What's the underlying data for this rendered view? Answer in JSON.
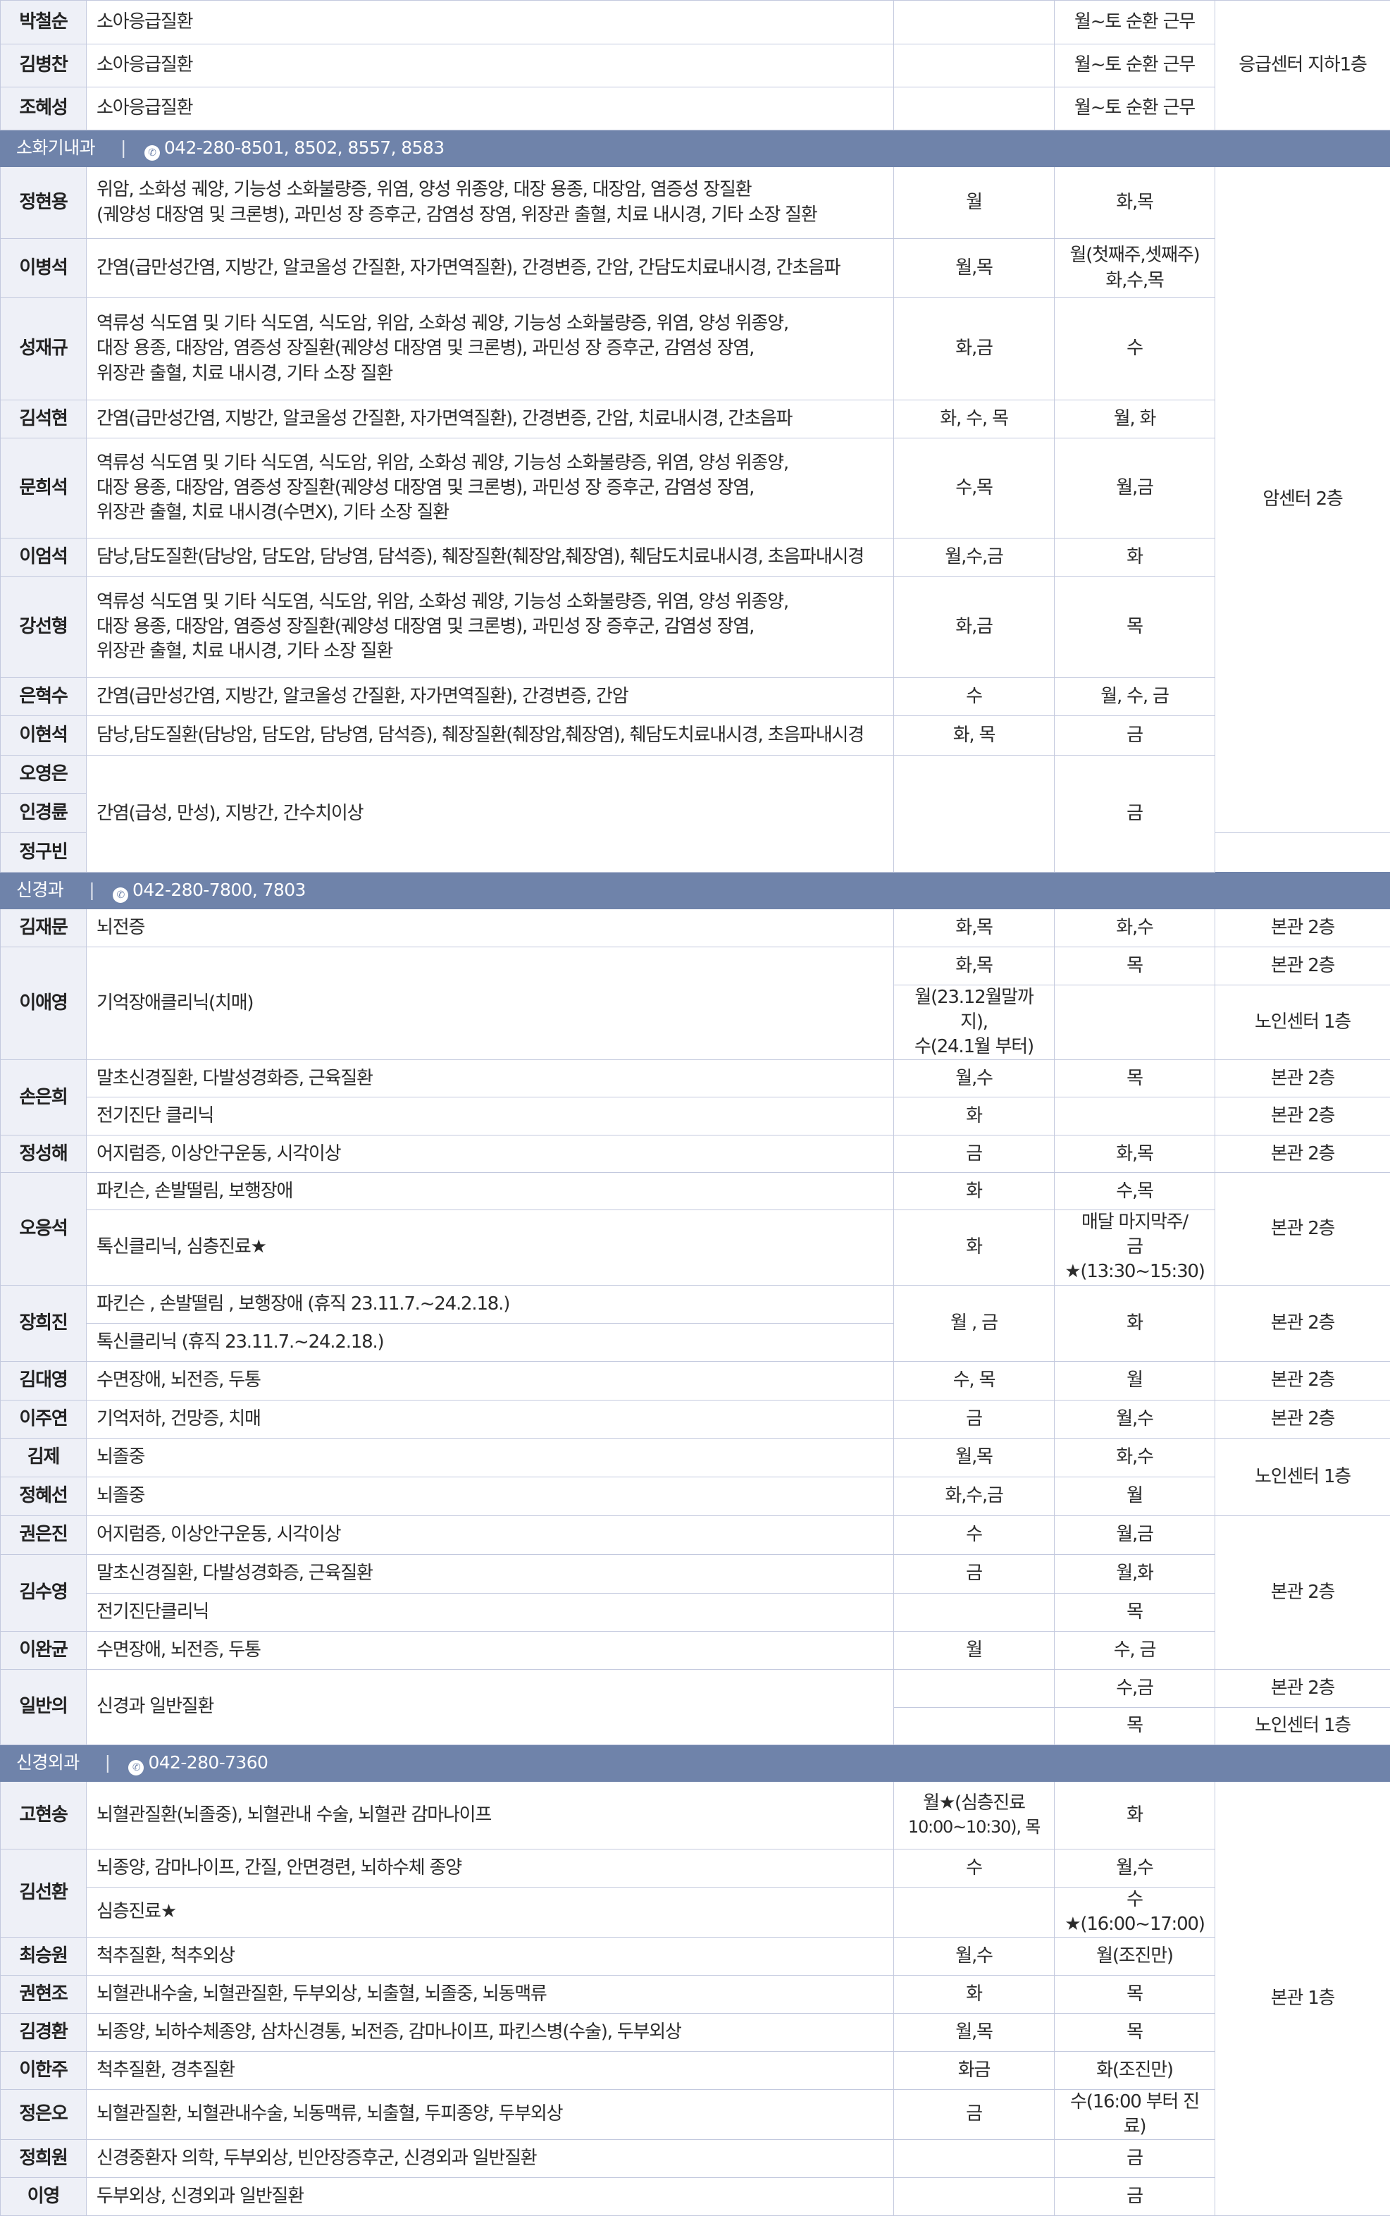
{
  "top": {
    "rows": [
      {
        "name": "박철순",
        "dx": "소아응급질환",
        "am": "",
        "pm": "월~토 순환 근무"
      },
      {
        "name": "김병찬",
        "dx": "소아응급질환",
        "am": "",
        "pm": "월~토 순환 근무"
      },
      {
        "name": "조혜성",
        "dx": "소아응급질환",
        "am": "",
        "pm": "월~토 순환 근무"
      }
    ],
    "loc": "응급센터 지하1층"
  },
  "gi": {
    "dept": "소화기내과",
    "phone": "042-280-8501, 8502, 8557, 8583",
    "phone_icon": "phone-icon",
    "loc": "암센터 2층",
    "r1": {
      "name": "정현용",
      "dx1": "위암, 소화성 궤양, 기능성 소화불량증, 위염, 양성 위종양, 대장 용종, 대장암, 염증성 장질환",
      "dx2": "(궤양성 대장염 및 크론병), 과민성 장 증후군, 감염성 장염, 위장관 출혈, 치료 내시경, 기타 소장 질환",
      "am": "월",
      "pm": "화,목"
    },
    "r2": {
      "name": "이병석",
      "dx": "간염(급만성간염, 지방간, 알코올성 간질환, 자가면역질환), 간경변증, 간암, 간담도치료내시경, 간초음파",
      "am": "월,목",
      "pm1": "월(첫째주,셋째주)",
      "pm2": "화,수,목"
    },
    "r3": {
      "name": "성재규",
      "dx1": "역류성 식도염 및 기타 식도염, 식도암, 위암, 소화성 궤양, 기능성 소화불량증, 위염, 양성 위종양,",
      "dx2": "대장 용종, 대장암, 염증성 장질환(궤양성 대장염 및 크론병), 과민성 장 증후군, 감염성 장염,",
      "dx3": "위장관 출혈, 치료 내시경, 기타 소장 질환",
      "am": "화,금",
      "pm": "수"
    },
    "r4": {
      "name": "김석현",
      "dx": "간염(급만성간염, 지방간, 알코올성 간질환, 자가면역질환), 간경변증, 간암, 치료내시경, 간초음파",
      "am": "화, 수, 목",
      "pm": "월, 화"
    },
    "r5": {
      "name": "문희석",
      "dx1": "역류성 식도염 및 기타 식도염, 식도암, 위암, 소화성 궤양, 기능성 소화불량증, 위염, 양성 위종양,",
      "dx2": "대장 용종, 대장암, 염증성 장질환(궤양성 대장염 및 크론병), 과민성 장 증후군, 감염성 장염,",
      "dx3": "위장관 출혈, 치료 내시경(수면X), 기타 소장 질환",
      "am": "수,목",
      "pm": "월,금"
    },
    "r6": {
      "name": "이엄석",
      "dx": "담낭,담도질환(담낭암, 담도암, 담낭염, 담석증), 췌장질환(췌장암,췌장염), 췌담도치료내시경, 초음파내시경",
      "am": "월,수,금",
      "pm": "화"
    },
    "r7": {
      "name": "강선형",
      "dx1": "역류성 식도염 및 기타 식도염, 식도암, 위암, 소화성 궤양, 기능성 소화불량증, 위염, 양성 위종양,",
      "dx2": "대장 용종, 대장암, 염증성 장질환(궤양성 대장염 및 크론병), 과민성 장 증후군, 감염성 장염,",
      "dx3": "위장관 출혈, 치료 내시경, 기타 소장 질환",
      "am": "화,금",
      "pm": "목"
    },
    "r8": {
      "name": "은혁수",
      "dx": "간염(급만성간염, 지방간, 알코올성 간질환, 자가면역질환), 간경변증, 간암",
      "am": "수",
      "pm": "월, 수, 금"
    },
    "r9": {
      "name": "이현석",
      "dx": "담낭,담도질환(담낭암, 담도암, 담낭염, 담석증), 췌장질환(췌장암,췌장염), 췌담도치료내시경, 초음파내시경",
      "am": "화, 목",
      "pm": "금"
    },
    "grp": {
      "n1": "오영은",
      "n2": "인경륜",
      "n3": "정구빈",
      "dx": "간염(급성, 만성), 지방간, 간수치이상",
      "am": "",
      "pm": "금"
    }
  },
  "neuro": {
    "dept": "신경과",
    "phone": "042-280-7800, 7803",
    "phone_icon": "phone-icon",
    "r1": {
      "name": "김재문",
      "dx": "뇌전증",
      "am": "화,목",
      "pm": "화,수",
      "loc": "본관 2층"
    },
    "r2": {
      "name": "이애영",
      "dx": "기억장애클리닉(치매)",
      "am1": "화,목",
      "pm1": "목",
      "loc1": "본관 2층",
      "am2a": "월(23.12월말까지),",
      "am2b": "수(24.1월 부터)",
      "pm2": "",
      "loc2": "노인센터 1층"
    },
    "r3": {
      "name": "손은희",
      "dx1": "말초신경질환, 다발성경화증, 근육질환",
      "am1": "월,수",
      "pm1": "목",
      "loc1": "본관 2층",
      "dx2": "전기진단 클리닉",
      "am2": "화",
      "pm2": "",
      "loc2": "본관 2층"
    },
    "r4": {
      "name": "정성해",
      "dx": "어지럼증, 이상안구운동, 시각이상",
      "am": "금",
      "pm": "화,목",
      "loc": "본관 2층"
    },
    "r5": {
      "name": "오응석",
      "dx1": "파킨슨, 손발떨림, 보행장애",
      "am1": "화",
      "pm1": "수,목",
      "dx2": "톡신클리닉, 심층진료★",
      "am2": "화",
      "pm2a": "매달 마지막주/",
      "pm2b": "금★(13:30~15:30)",
      "loc": "본관 2층"
    },
    "r6": {
      "name": "장희진",
      "dx1": "파킨슨 , 손발떨림 , 보행장애 (휴직 23.11.7.~24.2.18.)",
      "dx2": "톡신클리닉  (휴직 23.11.7.~24.2.18.)",
      "am": "월 , 금",
      "pm": "화",
      "loc": "본관 2층"
    },
    "r7": {
      "name": "김대영",
      "dx": "수면장애, 뇌전증, 두통",
      "am": "수, 목",
      "pm": "월",
      "loc": "본관 2층"
    },
    "r8": {
      "name": "이주연",
      "dx": "기억저하, 건망증, 치매",
      "am": "금",
      "pm": "월,수",
      "loc": "본관 2층"
    },
    "r9": {
      "name": "김제",
      "dx": "뇌졸중",
      "am": "월,목",
      "pm": "화,수"
    },
    "r10": {
      "name": "정혜선",
      "dx": "뇌졸중",
      "am": "화,수,금",
      "pm": "월"
    },
    "loc_9_10": "노인센터 1층",
    "r11": {
      "name": "권은진",
      "dx": "어지럼증, 이상안구운동, 시각이상",
      "am": "수",
      "pm": "월,금"
    },
    "r12": {
      "name": "김수영",
      "dx1": "말초신경질환, 다발성경화증, 근육질환",
      "am1": "금",
      "pm1": "월,화",
      "dx2": "전기진단클리닉",
      "am2": "",
      "pm2": "목"
    },
    "r13": {
      "name": "이완균",
      "dx": "수면장애, 뇌전증, 두통",
      "am": "월",
      "pm": "수, 금"
    },
    "loc_11_13": "본관 2층",
    "r14": {
      "name": "일반의",
      "dx": "신경과 일반질환",
      "am1": "",
      "pm1": "수,금",
      "loc1": "본관 2층",
      "am2": "",
      "pm2": "목",
      "loc2": "노인센터 1층"
    }
  },
  "ns": {
    "dept": "신경외과",
    "phone": "042-280-7360",
    "phone_icon": "phone-icon",
    "loc": "본관 1층",
    "r1": {
      "name": "고현송",
      "dx": "뇌혈관질환(뇌졸중), 뇌혈관내 수술, 뇌혈관 감마나이프",
      "am1": "월★(심층진료",
      "am2": "10:00~10:30), 목",
      "pm": "화"
    },
    "r2": {
      "name": "김선환",
      "dx1": "뇌종양, 감마나이프, 간질, 안면경련, 뇌하수체 종양",
      "am1": "수",
      "pm1": "월,수",
      "dx2": "심층진료★",
      "am2": "",
      "pm2": "수★(16:00~17:00)"
    },
    "r3": {
      "name": "최승원",
      "dx": "척추질환, 척추외상",
      "am": "월,수",
      "pm": "월(조진만)"
    },
    "r4": {
      "name": "권현조",
      "dx": "뇌혈관내수술, 뇌혈관질환, 두부외상, 뇌출혈, 뇌졸중, 뇌동맥류",
      "am": "화",
      "pm": "목"
    },
    "r5": {
      "name": "김경환",
      "dx": "뇌종양, 뇌하수체종양, 삼차신경통, 뇌전증, 감마나이프, 파킨스병(수술), 두부외상",
      "am": "월,목",
      "pm": "목"
    },
    "r6": {
      "name": "이한주",
      "dx": "척추질환, 경추질환",
      "am": "화금",
      "pm": "화(조진만)"
    },
    "r7": {
      "name": "정은오",
      "dx": "뇌혈관질환, 뇌혈관내수술, 뇌동맥류, 뇌출혈, 두피종양, 두부외상",
      "am": "금",
      "pm": "수(16:00 부터 진료)"
    },
    "r8": {
      "name": "정희원",
      "dx": "신경중환자 의학, 두부외상, 빈안장증후군, 신경외과 일반질환",
      "am": "",
      "pm": "금"
    },
    "r9": {
      "name": "이영",
      "dx": "두부외상, 신경외과 일반질환",
      "am": "",
      "pm": "금"
    }
  }
}
